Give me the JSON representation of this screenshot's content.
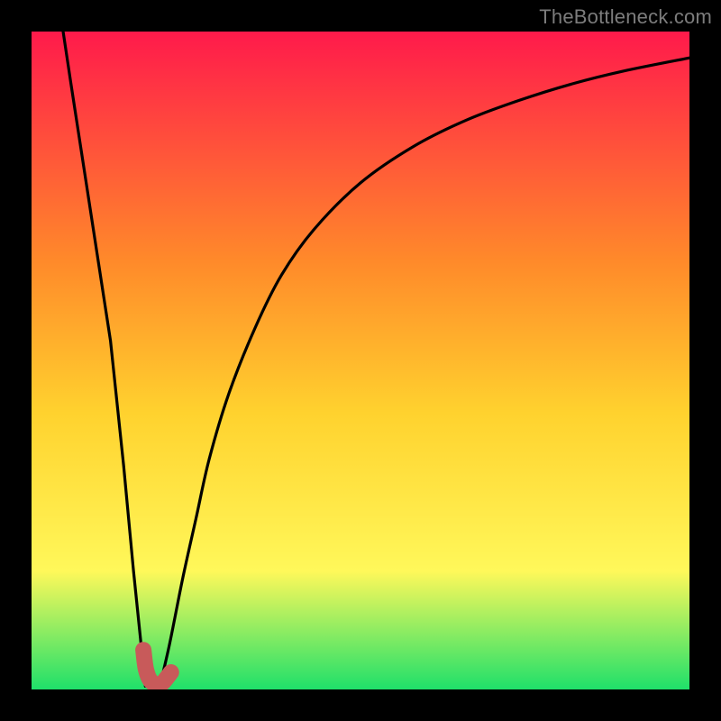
{
  "watermark": "TheBottleneck.com",
  "colors": {
    "frame": "#000000",
    "gradient_top": "#ff1a4b",
    "gradient_mid1": "#ff8a2a",
    "gradient_mid2": "#ffd22e",
    "gradient_mid3": "#fff85a",
    "gradient_bottom": "#1fe06a",
    "curve": "#000000",
    "marker": "#c85a5a"
  },
  "chart_data": {
    "type": "line",
    "title": "",
    "xlabel": "",
    "ylabel": "",
    "xlim": [
      0,
      100
    ],
    "ylim": [
      0,
      100
    ],
    "series": [
      {
        "name": "left-branch",
        "x": [
          4.8,
          6,
          8,
          10,
          12,
          14,
          15.5,
          17.3
        ],
        "y": [
          100,
          92,
          79,
          66,
          53,
          34,
          18,
          0.5
        ]
      },
      {
        "name": "right-branch",
        "x": [
          19.5,
          21,
          23,
          25,
          27,
          30,
          34,
          38,
          43,
          50,
          58,
          66,
          74,
          82,
          90,
          100
        ],
        "y": [
          0.5,
          7,
          17,
          26,
          35,
          45,
          55,
          63,
          70,
          77,
          82.5,
          86.5,
          89.5,
          92,
          94,
          96
        ]
      }
    ],
    "marker": {
      "name": "bottleneck-marker",
      "path_xy": [
        [
          17.0,
          6.0
        ],
        [
          17.4,
          3.0
        ],
        [
          18.2,
          1.2
        ],
        [
          19.6,
          0.8
        ],
        [
          21.2,
          2.6
        ]
      ],
      "stroke_width_px": 18
    }
  }
}
